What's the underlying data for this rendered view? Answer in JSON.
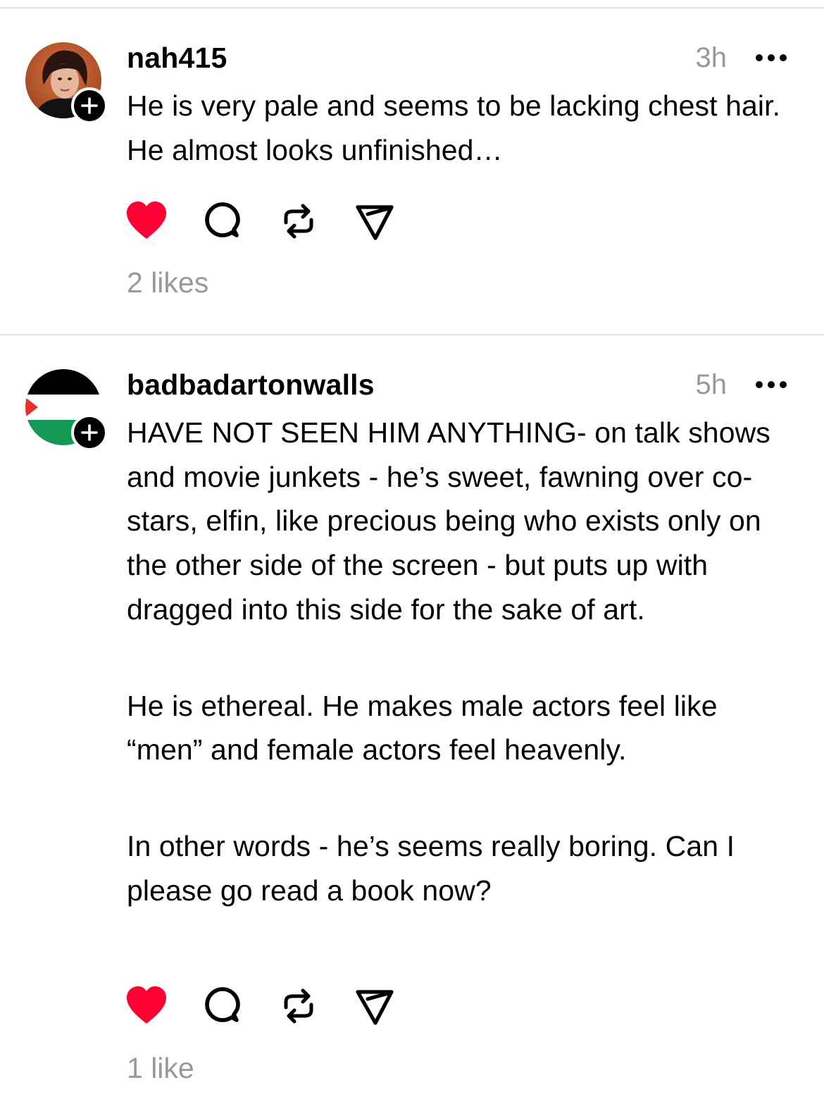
{
  "posts": [
    {
      "username": "nah415",
      "time": "3h",
      "paragraphs": [
        "He is very pale and seems to be lacking chest hair. He almost looks unfinished…"
      ],
      "likes": "2 likes",
      "liked": true,
      "avatar_icon": "profile-photo",
      "follow_icon": "plus-icon"
    },
    {
      "username": "badbadartonwalls",
      "time": "5h",
      "paragraphs": [
        "HAVE NOT SEEN HIM ANYTHING- on talk shows and movie junkets - he’s sweet, fawning over co-stars, elfin, like precious being who exists only on the other side of the screen - but puts up with dragged into this side for the sake of art.",
        "He is ethereal. He makes male actors feel like “men” and female actors feel heavenly.",
        "In other words - he’s seems really boring. Can I please go read a book now?"
      ],
      "likes": "1 like",
      "liked": true,
      "avatar_icon": "flag",
      "follow_icon": "plus-icon"
    }
  ],
  "actions": [
    "heart-icon",
    "comment-icon",
    "repost-icon",
    "share-icon"
  ],
  "colors": {
    "heart": "#ff0033",
    "muted": "#999999",
    "divider": "#e3e3e3",
    "flag_black": "#000000",
    "flag_green": "#149954",
    "flag_red": "#e4312b"
  }
}
